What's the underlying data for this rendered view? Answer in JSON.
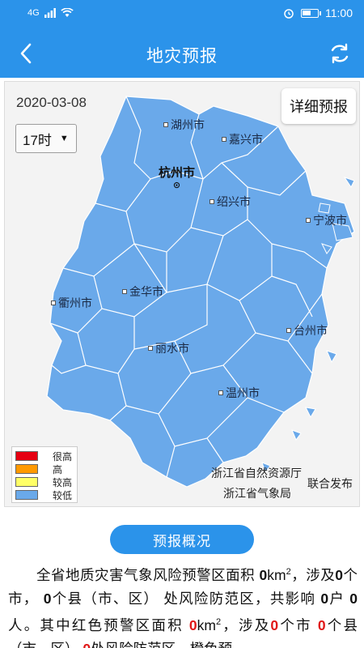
{
  "status_bar": {
    "signal": "4G",
    "time": "11:00",
    "battery_level": 0.6
  },
  "app_bar": {
    "title": "地灾预报"
  },
  "map": {
    "date": "2020-03-08",
    "hour_selected": "17时",
    "detail_button": "详细预报",
    "province_fill": "#6aa9ea",
    "cities": [
      {
        "name": "湖州市",
        "capital": false
      },
      {
        "name": "嘉兴市",
        "capital": false
      },
      {
        "name": "杭州市",
        "capital": true
      },
      {
        "name": "绍兴市",
        "capital": false
      },
      {
        "name": "宁波市",
        "capital": false
      },
      {
        "name": "金华市",
        "capital": false
      },
      {
        "name": "衢州市",
        "capital": false
      },
      {
        "name": "台州市",
        "capital": false
      },
      {
        "name": "丽水市",
        "capital": false
      },
      {
        "name": "温州市",
        "capital": false
      }
    ],
    "legend": [
      {
        "label": "很高",
        "color": "#e60012"
      },
      {
        "label": "高",
        "color": "#ff9900"
      },
      {
        "label": "较高",
        "color": "#ffff66"
      },
      {
        "label": "较低",
        "color": "#6aa9ea"
      }
    ],
    "publisher_1": "浙江省自然资源厅",
    "publisher_2": "浙江省气象局",
    "publish_suffix": "联合发布"
  },
  "overview_button": "预报概况",
  "summary": {
    "t1": "全省地质灾害气象风险预警区面积 ",
    "v1": "0",
    "t2": "km",
    "t3": "，涉及",
    "v2": "0",
    "t4": "个市， ",
    "v3": "0",
    "t5": "个县（市、区） 处风险防范区，共影响 ",
    "v4": "0",
    "t6": "户 ",
    "v5": "0",
    "t7": "人。其中红色预警区面积 ",
    "v6": "0",
    "t8": "km",
    "t9": "，涉及",
    "v7": "0",
    "t10": "个市 ",
    "v8": "0",
    "t11": "个县（市、区） ",
    "v9": "0",
    "t12": "处风险防范区，橙色预"
  }
}
